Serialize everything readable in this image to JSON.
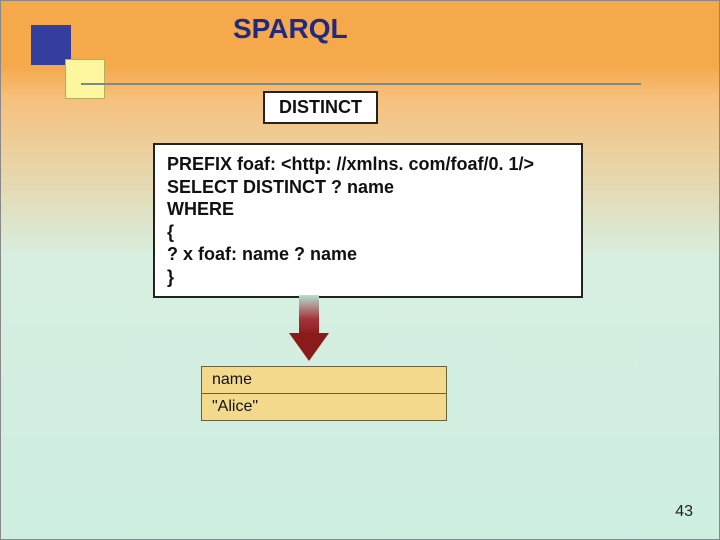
{
  "title": "SPARQL",
  "keyword_box": "DISTINCT",
  "query": {
    "line1": "PREFIX foaf: <http: //xmlns. com/foaf/0. 1/>",
    "line2": "SELECT DISTINCT ? name",
    "line3": "WHERE",
    "line4": "{",
    "line5": "? x foaf: name ? name",
    "line6": "}"
  },
  "result": {
    "header": "name",
    "rows": [
      "\"Alice\""
    ]
  },
  "page_number": "43"
}
